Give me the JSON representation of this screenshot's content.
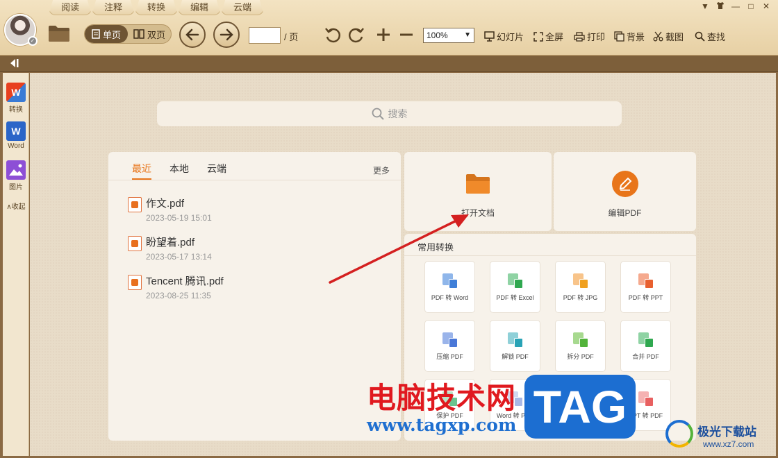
{
  "menu_tabs": [
    "阅读",
    "注释",
    "转换",
    "编辑",
    "云端"
  ],
  "window_controls": [
    "▼",
    "衣",
    "—",
    "□",
    "✕"
  ],
  "toolbar": {
    "view_single": "单页",
    "view_double": "双页",
    "page_value": "",
    "page_suffix": "/ 页",
    "zoom": "100%",
    "slideshow": "幻灯片",
    "fullscreen": "全屏",
    "print": "打印",
    "background": "背景",
    "screenshot": "截图",
    "find": "查找"
  },
  "sidebar": {
    "items": [
      {
        "label": "转换",
        "icon": "pdf-convert-icon"
      },
      {
        "label": "Word",
        "icon": "word-icon"
      },
      {
        "label": "图片",
        "icon": "image-icon"
      }
    ],
    "collapse_label": "∧收起"
  },
  "search": {
    "placeholder": "搜索"
  },
  "recent": {
    "tabs": [
      "最近",
      "本地",
      "云端"
    ],
    "active_tab": "最近",
    "more": "更多",
    "files": [
      {
        "name": "作文.pdf",
        "date": "2023-05-19 15:01"
      },
      {
        "name": "盼望着.pdf",
        "date": "2023-05-17 13:14"
      },
      {
        "name": "Tencent 腾讯.pdf",
        "date": "2023-08-25 11:35"
      }
    ]
  },
  "actions": {
    "open_label": "打开文档",
    "edit_label": "编辑PDF"
  },
  "convert": {
    "title": "常用转换",
    "tiles": [
      {
        "label": "PDF 转 Word",
        "color_a": "#8fb6ea",
        "color_b": "#3f7fd8"
      },
      {
        "label": "PDF 转 Excel",
        "color_a": "#8fd3a4",
        "color_b": "#2fa84f"
      },
      {
        "label": "PDF 转 JPG",
        "color_a": "#f8c48a",
        "color_b": "#f0a020"
      },
      {
        "label": "PDF 转 PPT",
        "color_a": "#f5a98e",
        "color_b": "#e8602f"
      },
      {
        "label": "压缩 PDF",
        "color_a": "#9ab4ea",
        "color_b": "#4a78d8"
      },
      {
        "label": "解锁 PDF",
        "color_a": "#8fd0d8",
        "color_b": "#29a3b6"
      },
      {
        "label": "拆分 PDF",
        "color_a": "#a7d98f",
        "color_b": "#52b33a"
      },
      {
        "label": "合并 PDF",
        "color_a": "#8fd3a4",
        "color_b": "#2fa84f"
      },
      {
        "label": "保护 PDF",
        "color_a": "#b9e3c9",
        "color_b": "#6cc48f"
      },
      {
        "label": "Word 转 PDF",
        "color_a": "#d0d8f0",
        "color_b": "#a8b8e6"
      },
      {
        "label": "",
        "color_a": "#f2d0e0",
        "color_b": "#e9a6c8"
      },
      {
        "label": "PPT 转 PDF",
        "color_a": "#f5b2b2",
        "color_b": "#e86060"
      }
    ]
  },
  "watermark": {
    "cn_text": "电脑技术网",
    "url": "www.tagxp.com",
    "tag": "TAG",
    "site_name": "极光下载站",
    "site_url": "www.xz7.com"
  },
  "colors": {
    "accent": "#e8751a",
    "toolbar_brown": "#6e5433",
    "annotation_arrow": "#d42020"
  }
}
